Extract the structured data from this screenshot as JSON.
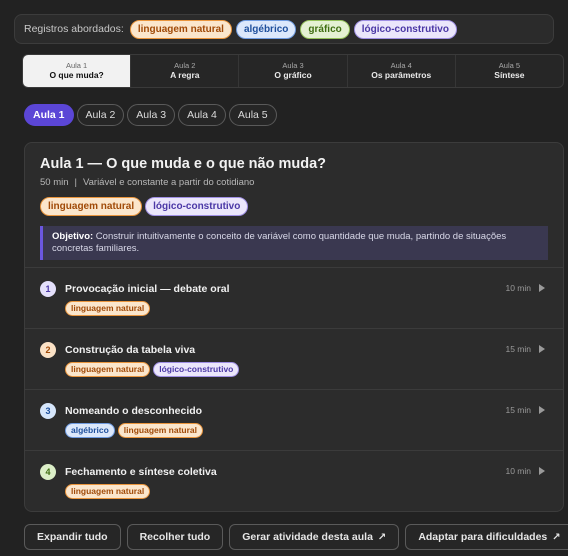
{
  "registers": {
    "label": "Registros abordados:",
    "chips": [
      {
        "text": "linguagem natural",
        "kind": "ling"
      },
      {
        "text": "algébrico",
        "kind": "alg"
      },
      {
        "text": "gráfico",
        "kind": "graf"
      },
      {
        "text": "lógico-construtivo",
        "kind": "log"
      }
    ]
  },
  "lesson_tabs": [
    {
      "number": "Aula 1",
      "title": "O que muda?",
      "active": true
    },
    {
      "number": "Aula 2",
      "title": "A regra",
      "active": false
    },
    {
      "number": "Aula 3",
      "title": "O gráfico",
      "active": false
    },
    {
      "number": "Aula 4",
      "title": "Os parâmetros",
      "active": false
    },
    {
      "number": "Aula 5",
      "title": "Síntese",
      "active": false
    }
  ],
  "pills": [
    "Aula 1",
    "Aula 2",
    "Aula 3",
    "Aula 4",
    "Aula 5"
  ],
  "lesson": {
    "title": "Aula 1 — O que muda e o que não muda?",
    "duration": "50 min",
    "separator": "|",
    "subtitle": "Variável e constante a partir do cotidiano",
    "objective_label": "Objetivo:",
    "objective_text": " Construir intuitivamente o conceito de variável como quantidade que muda, partindo de situações concretas familiares."
  },
  "steps": [
    {
      "number": "1",
      "title": "Provocação inicial — debate oral",
      "duration": "10 min"
    },
    {
      "number": "2",
      "title": "Construção da tabela viva",
      "duration": "15 min"
    },
    {
      "number": "3",
      "title": "Nomeando o desconhecido",
      "duration": "15 min"
    },
    {
      "number": "4",
      "title": "Fechamento e síntese coletiva",
      "duration": "10 min"
    }
  ],
  "chips_text": {
    "ling": "linguagem natural",
    "alg": "algébrico",
    "log": "lógico-construtivo"
  },
  "actions": {
    "expand": "Expandir tudo",
    "collapse": "Recolher tudo",
    "generate": "Gerar atividade desta aula",
    "adapt": "Adaptar para dificuldades",
    "arrow": "↗"
  },
  "icons": {
    "play": "play-icon",
    "external": "arrow-up-right-icon"
  },
  "colors": {
    "accent": "#5b46d6",
    "background": "#222222"
  }
}
